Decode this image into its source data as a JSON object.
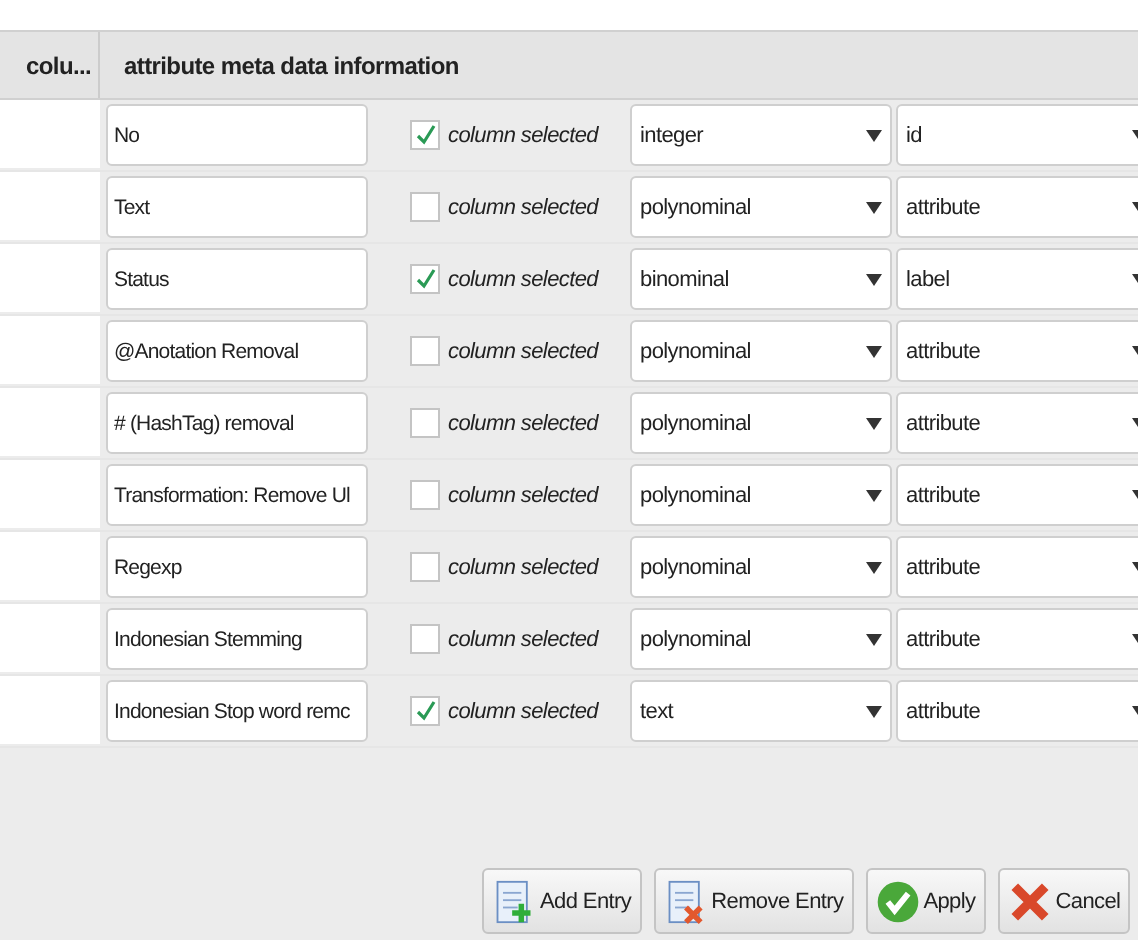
{
  "table": {
    "columns": [
      "colu...",
      "attribute meta data information"
    ],
    "rows": [
      {
        "name": "No",
        "checked": true,
        "check_label": "column selected",
        "type": "integer",
        "role": "id"
      },
      {
        "name": "Text",
        "checked": false,
        "check_label": "column selected",
        "type": "polynominal",
        "role": "attribute"
      },
      {
        "name": "Status",
        "checked": true,
        "check_label": "column selected",
        "type": "binominal",
        "role": "label"
      },
      {
        "name": "@Anotation Removal",
        "checked": false,
        "check_label": "column selected",
        "type": "polynominal",
        "role": "attribute"
      },
      {
        "name": "# (HashTag) removal",
        "checked": false,
        "check_label": "column selected",
        "type": "polynominal",
        "role": "attribute"
      },
      {
        "name": "Transformation: Remove Ul",
        "checked": false,
        "check_label": "column selected",
        "type": "polynominal",
        "role": "attribute"
      },
      {
        "name": "Regexp",
        "checked": false,
        "check_label": "column selected",
        "type": "polynominal",
        "role": "attribute"
      },
      {
        "name": "Indonesian Stemming",
        "checked": false,
        "check_label": "column selected",
        "type": "polynominal",
        "role": "attribute"
      },
      {
        "name": "Indonesian Stop word remc",
        "checked": true,
        "check_label": "column selected",
        "type": "text",
        "role": "attribute"
      }
    ]
  },
  "buttons": [
    {
      "kind": "add",
      "label": "Add Entry"
    },
    {
      "kind": "remove",
      "label": "Remove Entry"
    },
    {
      "kind": "apply",
      "label": "Apply"
    },
    {
      "kind": "cancel",
      "label": "Cancel"
    }
  ]
}
